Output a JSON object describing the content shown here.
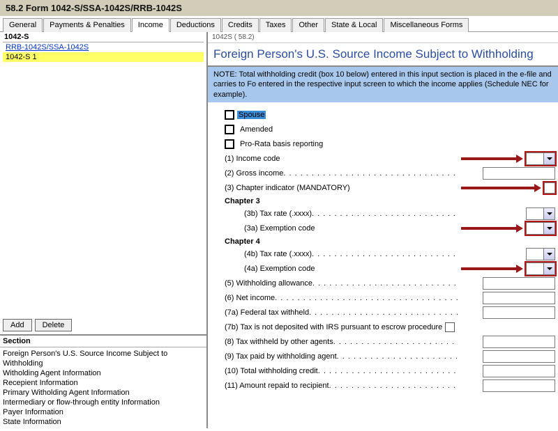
{
  "titlebar": "58.2    Form 1042-S/SSA-1042S/RRB-1042S",
  "crumb": "1042S  ( 58.2)",
  "tabs": [
    "General",
    "Payments & Penalties",
    "Income",
    "Deductions",
    "Credits",
    "Taxes",
    "Other",
    "State & Local",
    "Miscellaneous Forms"
  ],
  "tree": {
    "head": "1042-S",
    "link": "RRB-1042S/SSA-1042S",
    "selected": "1042-S 1"
  },
  "buttons": {
    "add": "Add",
    "delete": "Delete"
  },
  "section_head": "Section",
  "sections": [
    "Foreign Person's U.S. Source Income Subject to",
    "Withholding",
    "Witholding Agent Information",
    "Recepient Information",
    "Primary Witholding Agent Information",
    "Intermediary or flow-through entity Information",
    "Payer Information",
    "State Information"
  ],
  "form_title": "Foreign Person's U.S. Source Income Subject to Withholding",
  "note": "NOTE: Total withholding credit (box 10 below) entered in this input section is placed in the e-file and carries to Fo entered in the respective input screen to which the income applies (Schedule NEC for example).",
  "checks": {
    "spouse": "Spouse",
    "amended": "Amended",
    "prorata": "Pro-Rata basis reporting"
  },
  "fields": {
    "f1": "(1) Income code",
    "f2": "(2) Gross income",
    "f3": "(3) Chapter indicator (MANDATORY)",
    "ch3": "Chapter 3",
    "f3b": "(3b) Tax rate (.xxxx)",
    "f3a": "(3a) Exemption code",
    "ch4": "Chapter 4",
    "f4b": "(4b) Tax rate (.xxxx)",
    "f4a": "(4a) Exemption code",
    "f5": "(5) Withholding allowance",
    "f6": "(6) Net income",
    "f7a": "(7a) Federal tax withheld",
    "f7b": "(7b) Tax is not deposited with IRS pursuant to escrow procedure",
    "f8": "(8) Tax withheld by other agents",
    "f9": "(9) Tax paid by withholding agent",
    "f10": "(10) Total withholding credit",
    "f11": "(11) Amount repaid to recipient"
  },
  "dots": ". . . . . . . . . . . . . . . . . . . . . . . . . . . . . . . . . . . . . . . . . . . . . . . . . . . . . . . . . . ."
}
